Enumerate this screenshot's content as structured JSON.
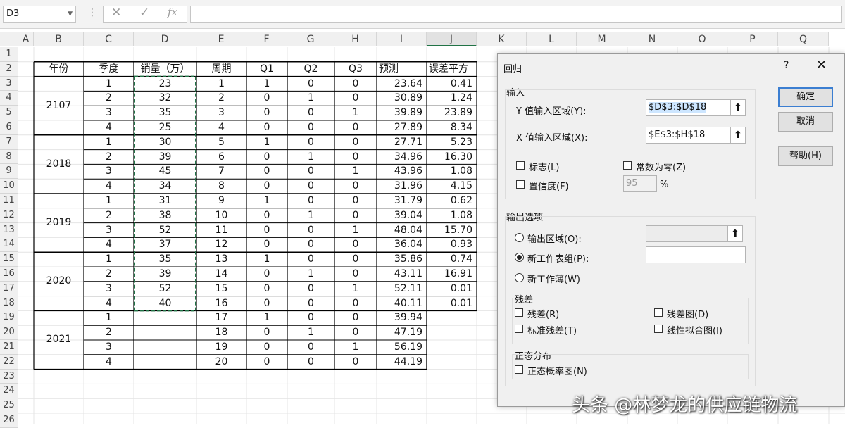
{
  "formula_bar": {
    "name_box": "D3",
    "fx_label": "fx",
    "formula": ""
  },
  "columns": [
    "A",
    "B",
    "C",
    "D",
    "E",
    "F",
    "G",
    "H",
    "I",
    "J",
    "K",
    "L",
    "M",
    "N",
    "O",
    "P",
    "Q"
  ],
  "rows": [
    "1",
    "2",
    "3",
    "4",
    "5",
    "6",
    "7",
    "8",
    "9",
    "10",
    "11",
    "12",
    "13",
    "14",
    "15",
    "16",
    "17",
    "18",
    "19",
    "20",
    "21",
    "22",
    "23",
    "24",
    "25",
    "26"
  ],
  "table": {
    "headers": [
      "年份",
      "季度",
      "销量（万）",
      "周期",
      "Q1",
      "Q2",
      "Q3",
      "预测",
      "误差平方"
    ],
    "years": [
      "2107",
      "2018",
      "2019",
      "2020",
      "2021"
    ],
    "rows": [
      {
        "q": "1",
        "sales": "23",
        "period": "1",
        "q1": "1",
        "q2": "0",
        "q3": "0",
        "pred": "23.64",
        "err": "0.41"
      },
      {
        "q": "2",
        "sales": "32",
        "period": "2",
        "q1": "0",
        "q2": "1",
        "q3": "0",
        "pred": "30.89",
        "err": "1.24"
      },
      {
        "q": "3",
        "sales": "35",
        "period": "3",
        "q1": "0",
        "q2": "0",
        "q3": "1",
        "pred": "39.89",
        "err": "23.89"
      },
      {
        "q": "4",
        "sales": "25",
        "period": "4",
        "q1": "0",
        "q2": "0",
        "q3": "0",
        "pred": "27.89",
        "err": "8.34"
      },
      {
        "q": "1",
        "sales": "30",
        "period": "5",
        "q1": "1",
        "q2": "0",
        "q3": "0",
        "pred": "27.71",
        "err": "5.23"
      },
      {
        "q": "2",
        "sales": "39",
        "period": "6",
        "q1": "0",
        "q2": "1",
        "q3": "0",
        "pred": "34.96",
        "err": "16.30"
      },
      {
        "q": "3",
        "sales": "45",
        "period": "7",
        "q1": "0",
        "q2": "0",
        "q3": "1",
        "pred": "43.96",
        "err": "1.08"
      },
      {
        "q": "4",
        "sales": "34",
        "period": "8",
        "q1": "0",
        "q2": "0",
        "q3": "0",
        "pred": "31.96",
        "err": "4.15"
      },
      {
        "q": "1",
        "sales": "31",
        "period": "9",
        "q1": "1",
        "q2": "0",
        "q3": "0",
        "pred": "31.79",
        "err": "0.62"
      },
      {
        "q": "2",
        "sales": "38",
        "period": "10",
        "q1": "0",
        "q2": "1",
        "q3": "0",
        "pred": "39.04",
        "err": "1.08"
      },
      {
        "q": "3",
        "sales": "52",
        "period": "11",
        "q1": "0",
        "q2": "0",
        "q3": "1",
        "pred": "48.04",
        "err": "15.70"
      },
      {
        "q": "4",
        "sales": "37",
        "period": "12",
        "q1": "0",
        "q2": "0",
        "q3": "0",
        "pred": "36.04",
        "err": "0.93"
      },
      {
        "q": "1",
        "sales": "35",
        "period": "13",
        "q1": "1",
        "q2": "0",
        "q3": "0",
        "pred": "35.86",
        "err": "0.74"
      },
      {
        "q": "2",
        "sales": "39",
        "period": "14",
        "q1": "0",
        "q2": "1",
        "q3": "0",
        "pred": "43.11",
        "err": "16.91"
      },
      {
        "q": "3",
        "sales": "52",
        "period": "15",
        "q1": "0",
        "q2": "0",
        "q3": "1",
        "pred": "52.11",
        "err": "0.01"
      },
      {
        "q": "4",
        "sales": "40",
        "period": "16",
        "q1": "0",
        "q2": "0",
        "q3": "0",
        "pred": "40.11",
        "err": "0.01"
      },
      {
        "q": "1",
        "sales": "",
        "period": "17",
        "q1": "1",
        "q2": "0",
        "q3": "0",
        "pred": "39.94",
        "err": ""
      },
      {
        "q": "2",
        "sales": "",
        "period": "18",
        "q1": "0",
        "q2": "1",
        "q3": "0",
        "pred": "47.19",
        "err": ""
      },
      {
        "q": "3",
        "sales": "",
        "period": "19",
        "q1": "0",
        "q2": "0",
        "q3": "1",
        "pred": "56.19",
        "err": ""
      },
      {
        "q": "4",
        "sales": "",
        "period": "20",
        "q1": "0",
        "q2": "0",
        "q3": "0",
        "pred": "44.19",
        "err": ""
      }
    ]
  },
  "dialog": {
    "title": "回归",
    "help_glyph": "?",
    "close_glyph": "✕",
    "input_group": "输入",
    "y_label": "Y 值输入区域(Y):",
    "y_value": "$D$3:$D$18",
    "x_label": "X 值输入区域(X):",
    "x_value": "$E$3:$H$18",
    "labels_chk": "标志(L)",
    "const_zero_chk": "常数为零(Z)",
    "confidence_chk": "置信度(F)",
    "confidence_value": "95",
    "percent": "%",
    "output_group": "输出选项",
    "out_range": "输出区域(O):",
    "new_sheet": "新工作表组(P):",
    "new_book": "新工作薄(W)",
    "residual_group": "残差",
    "residuals": "残差(R)",
    "residual_plots": "残差图(D)",
    "std_residuals": "标准残差(T)",
    "line_fit": "线性拟合图(I)",
    "normal_group": "正态分布",
    "normal_plot": "正态概率图(N)",
    "ok": "确定",
    "cancel": "取消",
    "help": "帮助(H)",
    "ref_icon": "collapse-dialog-icon"
  },
  "watermark": "头条 @林梦龙的供应链物流"
}
